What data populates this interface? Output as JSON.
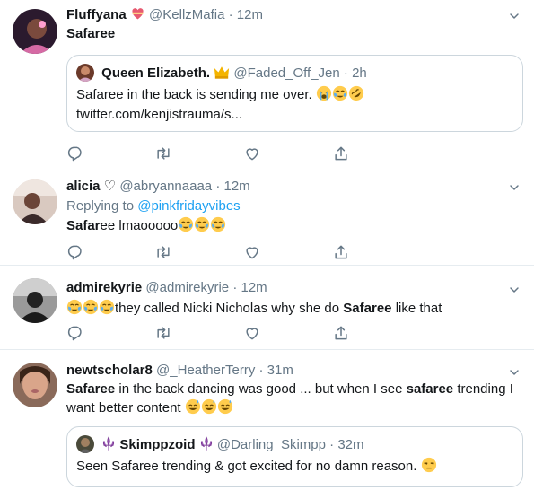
{
  "tweets": [
    {
      "name": "Fluffyana",
      "handle": "@KellzMafia",
      "sep": "·",
      "time": "12m",
      "text": "Safaree",
      "quote": {
        "name": "Queen Elizabeth.",
        "handle": "@Faded_Off_Jen",
        "sep": "·",
        "time": "2h",
        "line1": "Safaree in the back is sending me over.",
        "line2": "twitter.com/kenjistrauma/s..."
      }
    },
    {
      "name": "alicia",
      "name_suffix": "♡",
      "handle": "@abryannaaaa",
      "sep": "·",
      "time": "12m",
      "replying_prefix": "Replying to",
      "replying_to": "@pinkfridayvibes",
      "text_bold": "Safar",
      "text_rest": "ee lmaooooo"
    },
    {
      "name": "admirekyrie",
      "handle": "@admirekyrie",
      "sep": "·",
      "time": "12m",
      "text_pre": "they called Nicki Nicholas why she do",
      "text_bold": "Safaree",
      "text_post": "like that"
    },
    {
      "name": "newtscholar8",
      "handle": "@_HeatherTerry",
      "sep": "·",
      "time": "31m",
      "line1_bold1": "Safaree",
      "line1_mid": "in the back dancing was good ... but when I see",
      "line1_bold2": "safaree",
      "line1_post": "trending I",
      "line2": "want better content",
      "quote": {
        "name": "Skimppzoid",
        "handle": "@Darling_Skimpp",
        "sep": "·",
        "time": "32m",
        "line1": "Seen Safaree trending & got excited for no damn reason."
      }
    }
  ],
  "icons": [
    "reply-icon",
    "retweet-icon",
    "like-icon",
    "share-icon",
    "chevron-down-icon"
  ],
  "colors": {
    "text": "#14171a",
    "muted": "#657786",
    "link": "#1da1f2",
    "divider": "#e6ecf0"
  }
}
